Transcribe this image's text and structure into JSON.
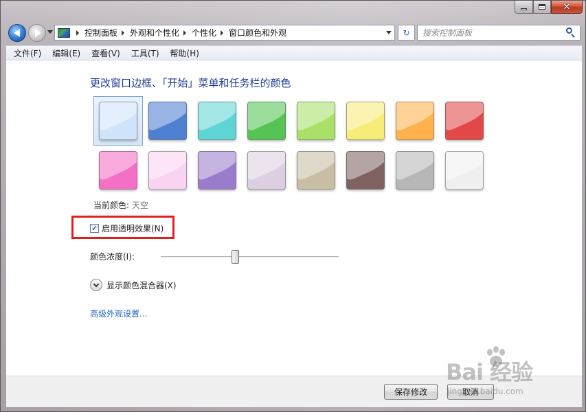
{
  "window": {
    "caption_minimize": "",
    "caption_maximize": "",
    "caption_close": "✕"
  },
  "nav": {
    "breadcrumb": [
      "控制面板",
      "外观和个性化",
      "个性化",
      "窗口颜色和外观"
    ],
    "search_placeholder": "搜索控制面板",
    "refresh_symbol": "↻"
  },
  "menu": {
    "items": [
      "文件(F)",
      "编辑(E)",
      "查看(V)",
      "工具(T)",
      "帮助(H)"
    ]
  },
  "main": {
    "heading": "更改窗口边框、「开始」菜单和任务栏的颜色",
    "swatch_colors": [
      "#cfe3fa",
      "#4f7fd0",
      "#5fd4d4",
      "#55c455",
      "#a8e068",
      "#f7ec78",
      "#ffb24c",
      "#e24848",
      "#f46fc6",
      "#f8d3f2",
      "#9b7ccc",
      "#ddcfe2",
      "#c9bda4",
      "#806262",
      "#b7b7b7",
      "#f0f0f0"
    ],
    "selected_swatch": 0,
    "current_color_label": "当前颜色:",
    "current_color_value": "天空",
    "transparency_label": "启用透明效果(N)",
    "transparency_checked": true,
    "intensity_label": "颜色浓度(I):",
    "intensity_level": 0.42,
    "mixer_label": "显示颜色混合器(X)",
    "advanced_link": "高级外观设置..."
  },
  "footer": {
    "save_label": "保存修改",
    "cancel_label": "取消"
  },
  "watermark": {
    "logo_text": "Bai 经验",
    "url": "jingyan.baidu.com"
  },
  "colors": {
    "heading": "#1e3c96",
    "link": "#1f63c6",
    "highlight_box": "#e0201f"
  }
}
